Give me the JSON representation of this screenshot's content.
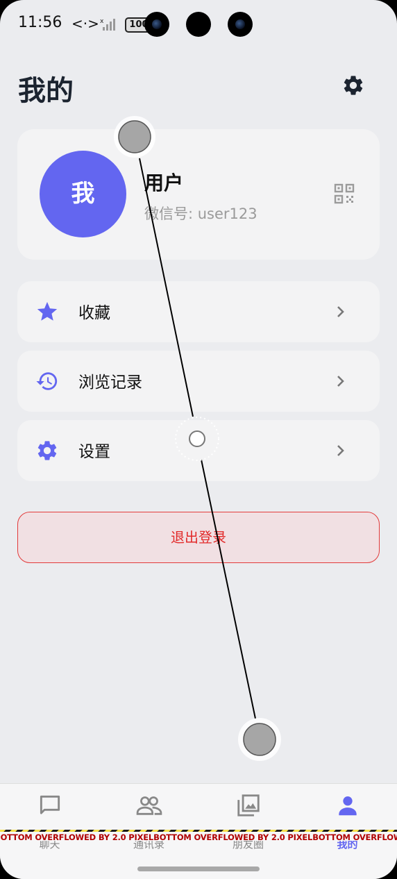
{
  "status_bar": {
    "time": "11:56",
    "battery": "100"
  },
  "header": {
    "title": "我的"
  },
  "profile": {
    "avatar_text": "我",
    "name": "用户",
    "wechat_id": "微信号: user123"
  },
  "menu": [
    {
      "label": "收藏",
      "icon": "star-icon"
    },
    {
      "label": "浏览记录",
      "icon": "history-icon"
    },
    {
      "label": "设置",
      "icon": "gear-icon"
    }
  ],
  "logout_label": "退出登录",
  "tabs": [
    {
      "label": "聊天",
      "icon": "chat-icon",
      "active": false
    },
    {
      "label": "通讯录",
      "icon": "contacts-icon",
      "active": false
    },
    {
      "label": "朋友圈",
      "icon": "gallery-icon",
      "active": false
    },
    {
      "label": "我的",
      "icon": "person-icon",
      "active": true
    }
  ],
  "overflow_warning": "BOTTOM OVERFLOWED BY 2.0 PIXELS",
  "colors": {
    "accent": "#6366F0",
    "danger": "#E22A2A",
    "background": "#EBECEF",
    "card": "#F3F3F4"
  }
}
